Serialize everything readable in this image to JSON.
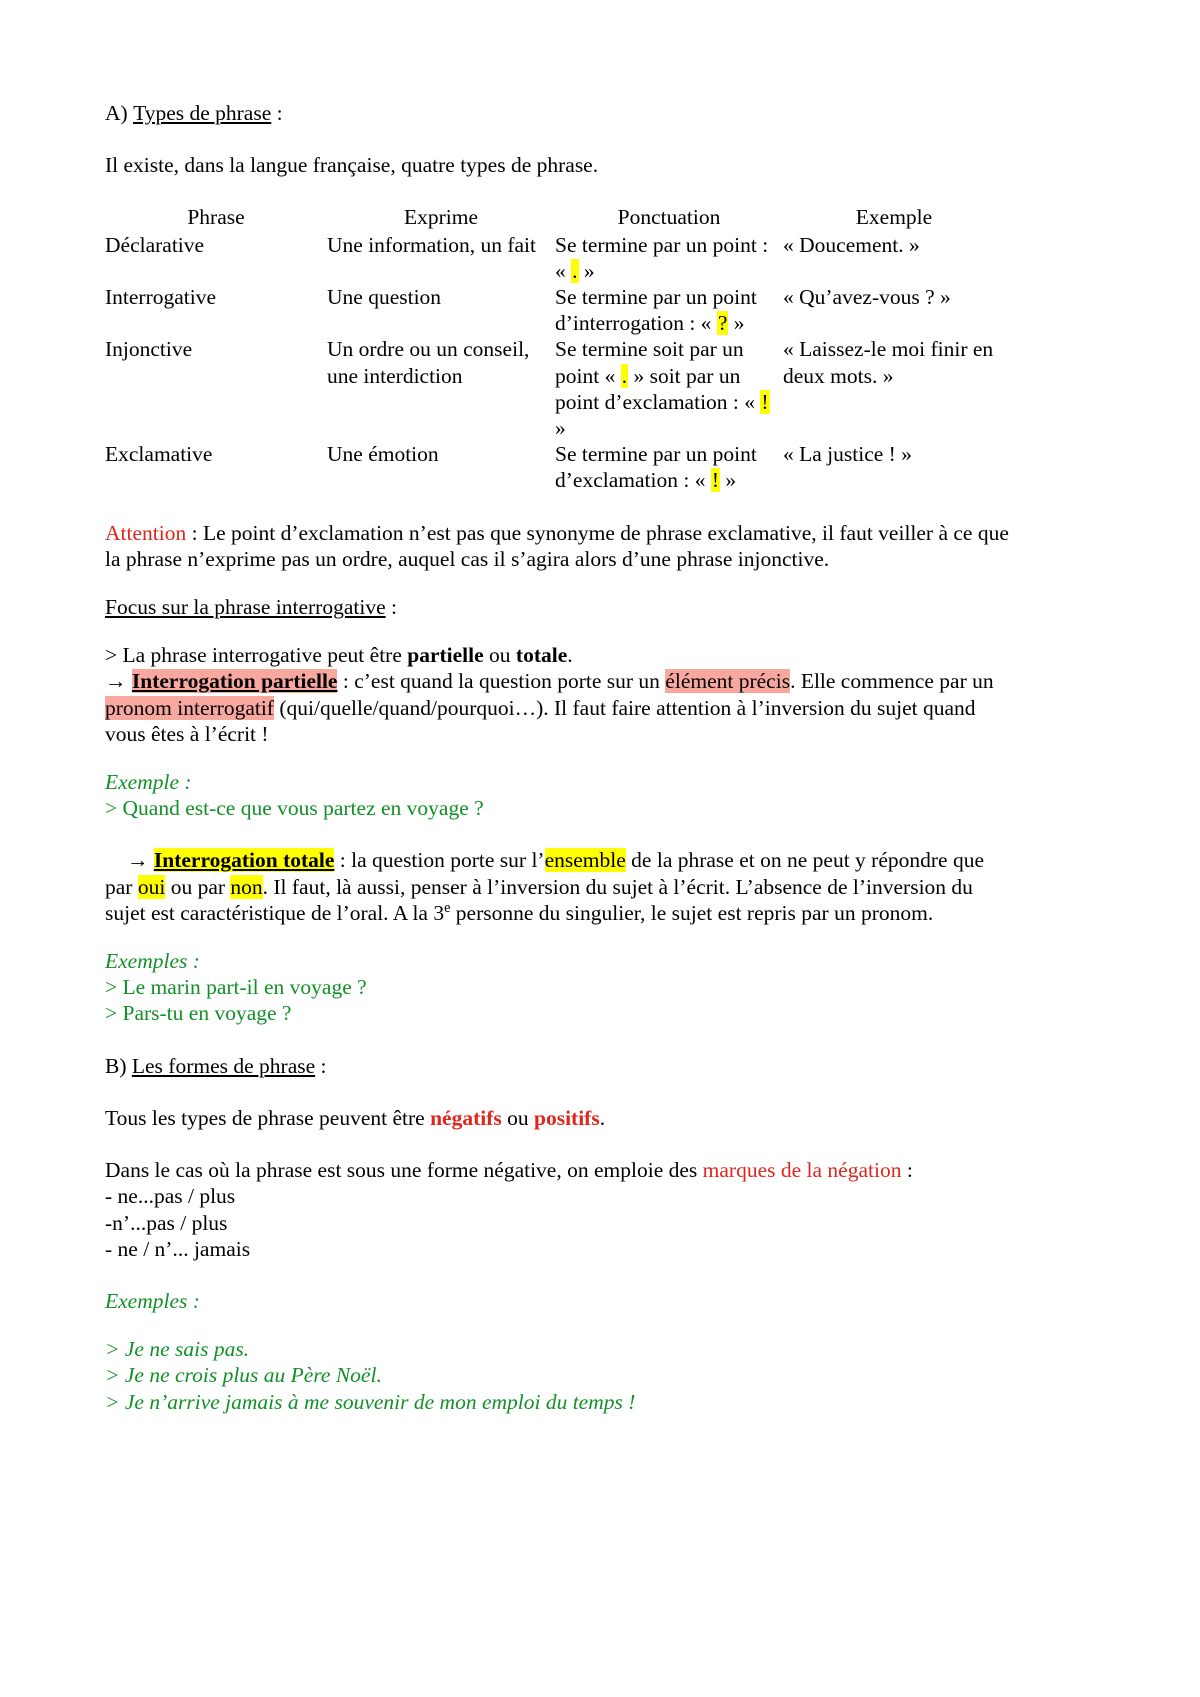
{
  "document": {
    "sections": {
      "a": {
        "label": "A)",
        "title": "Types de phrase",
        "colon": " :",
        "intro": "Il existe, dans la langue française, quatre types de phrase."
      },
      "b": {
        "label": "B)",
        "title": "Les formes de phrase",
        "colon": " :"
      }
    },
    "table": {
      "headers": [
        "Phrase",
        "Exprime",
        "Ponctuation",
        "Exemple"
      ],
      "rows": [
        {
          "phrase": "Déclarative",
          "exprime": "Une information, un fait",
          "ponctuation_pre": "Se termine par un point : « ",
          "ponctuation_mark": ".",
          "ponctuation_post": " »",
          "exemple": "« Doucement. »"
        },
        {
          "phrase": "Interrogative",
          "exprime": "Une question",
          "ponctuation_pre": "Se termine par un point d’interrogation : « ",
          "ponctuation_mark": "?",
          "ponctuation_post": " »",
          "exemple": "« Qu’avez-vous ? »"
        },
        {
          "phrase": "Injonctive",
          "exprime": "Un ordre ou un conseil, une interdiction",
          "ponctuation_pre": "Se termine soit par un point « ",
          "ponctuation_mark": ".",
          "ponctuation_mid": " » soit par un point d’exclamation : « ",
          "ponctuation_mark2": "!",
          "ponctuation_post": " »",
          "exemple": "« Laissez-le moi finir en deux mots. »"
        },
        {
          "phrase": "Exclamative",
          "exprime": "Une émotion",
          "ponctuation_pre": "Se termine par un point d’exclamation : « ",
          "ponctuation_mark": "!",
          "ponctuation_post": " »",
          "exemple": "« La justice ! »"
        }
      ]
    },
    "attention": {
      "keyword": "Attention",
      "body": " : Le point d’exclamation n’est pas que synonyme de phrase exclamative, il faut veiller à ce que la phrase n’exprime pas un ordre, auquel cas il s’agira alors d’une phrase injonctive."
    },
    "focus": {
      "title": "Focus sur la phrase interrogative",
      "colon": " :"
    },
    "partielle": {
      "lead_pre": "> La phrase interrogative peut être ",
      "lead_bold1": "partielle",
      "lead_mid": " ou ",
      "lead_bold2": "totale",
      "lead_end": ".",
      "arrow": "→",
      "term": "Interrogation partielle",
      "after_term": " : c’est quand la question porte sur un ",
      "hl_element": "élément précis",
      "after_hl": ". Elle commence par un ",
      "hl_pronom": "pronom interrogatif",
      "tail": " (qui/quelle/quand/pourquoi…). Il faut faire attention à l’inversion du sujet quand vous êtes à l’écrit !"
    },
    "example_partielle": {
      "label": "Exemple",
      "colon": " :",
      "lines": [
        "> Quand est-ce que vous partez en voyage ?"
      ]
    },
    "totale": {
      "arrow": "→",
      "term": "Interrogation totale",
      "after_term": " : la question porte sur l’",
      "hl_ensemble": "ensemble",
      "after_hl": " de la phrase et on ne peut y répondre que par ",
      "hl_oui": "oui",
      "mid": " ou par ",
      "hl_non": "non",
      "tail_a": ". Il faut, là aussi, penser à l’inversion du sujet à l’écrit. L’absence de l’inversion du sujet est caractéristique de l’oral. A la 3",
      "sup": "e",
      "tail_b": " personne du singulier, le sujet est repris par un pronom."
    },
    "examples_totale": {
      "label": "Exemples",
      "colon": " :",
      "lines": [
        "> Le marin part-il en voyage ?",
        "> Pars-tu en voyage ?"
      ]
    },
    "formes": {
      "line_pre": "Tous les types de phrase peuvent être ",
      "bold_neg": "négatifs",
      "line_mid": " ou ",
      "bold_pos": "positifs",
      "line_end": ".",
      "neg_pre": "Dans le cas où la phrase est sous une forme négative, on emploie des ",
      "neg_red": "marques de la négation",
      "neg_post": " :",
      "marks": [
        "- ne...pas / plus",
        "-n’...pas / plus",
        "- ne / n’... jamais"
      ]
    },
    "examples_negation": {
      "label": "Exemples",
      "colon": " :",
      "lines": [
        "> Je ne sais pas.",
        "> Je ne crois plus au Père Noël.",
        "> Je n’arrive jamais à me souvenir de mon emploi du temps !"
      ]
    }
  },
  "colors": {
    "red": "#e0251c",
    "green": "#119027",
    "highlight_yellow": "#ffff00",
    "highlight_pink": "#f9a8a0",
    "text": "#000000",
    "background": "#ffffff"
  }
}
